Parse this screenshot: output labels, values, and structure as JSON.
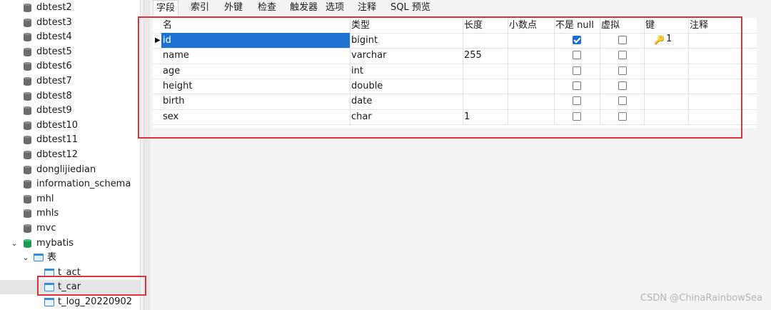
{
  "tree": {
    "items": [
      {
        "label": "dbtest2",
        "type": "db"
      },
      {
        "label": "dbtest3",
        "type": "db"
      },
      {
        "label": "dbtest4",
        "type": "db"
      },
      {
        "label": "dbtest5",
        "type": "db"
      },
      {
        "label": "dbtest6",
        "type": "db"
      },
      {
        "label": "dbtest7",
        "type": "db"
      },
      {
        "label": "dbtest8",
        "type": "db"
      },
      {
        "label": "dbtest9",
        "type": "db"
      },
      {
        "label": "dbtest10",
        "type": "db"
      },
      {
        "label": "dbtest11",
        "type": "db"
      },
      {
        "label": "dbtest12",
        "type": "db"
      },
      {
        "label": "donglijiedian",
        "type": "db"
      },
      {
        "label": "information_schema",
        "type": "db"
      },
      {
        "label": "mhl",
        "type": "db"
      },
      {
        "label": "mhls",
        "type": "db"
      },
      {
        "label": "mvc",
        "type": "db"
      },
      {
        "label": "mybatis",
        "type": "db-open"
      },
      {
        "label": "表",
        "type": "folder"
      },
      {
        "label": "t_act",
        "type": "table"
      },
      {
        "label": "t_car",
        "type": "table-selected"
      },
      {
        "label": "t_log_20220902",
        "type": "table"
      }
    ]
  },
  "tabs": [
    "字段",
    "索引",
    "外键",
    "检查",
    "触发器",
    "选项",
    "注释",
    "SQL 预览"
  ],
  "grid": {
    "headers": [
      "名",
      "类型",
      "长度",
      "小数点",
      "不是 null",
      "虚拟",
      "键",
      "注释"
    ],
    "rows": [
      {
        "name": "id",
        "type": "bigint",
        "length": "",
        "decimals": "",
        "not_null": true,
        "virtual": false,
        "key": "1"
      },
      {
        "name": "name",
        "type": "varchar",
        "length": "255",
        "decimals": "",
        "not_null": false,
        "virtual": false,
        "key": ""
      },
      {
        "name": "age",
        "type": "int",
        "length": "",
        "decimals": "",
        "not_null": false,
        "virtual": false,
        "key": ""
      },
      {
        "name": "height",
        "type": "double",
        "length": "",
        "decimals": "",
        "not_null": false,
        "virtual": false,
        "key": ""
      },
      {
        "name": "birth",
        "type": "date",
        "length": "",
        "decimals": "",
        "not_null": false,
        "virtual": false,
        "key": ""
      },
      {
        "name": "sex",
        "type": "char",
        "length": "1",
        "decimals": "",
        "not_null": false,
        "virtual": false,
        "key": ""
      }
    ]
  },
  "watermark": "CSDN @ChinaRainbowSea",
  "colors": {
    "selection": "#1e73d2",
    "annotation": "#d9343c",
    "checkbox_checked": "#1e6fd1"
  }
}
